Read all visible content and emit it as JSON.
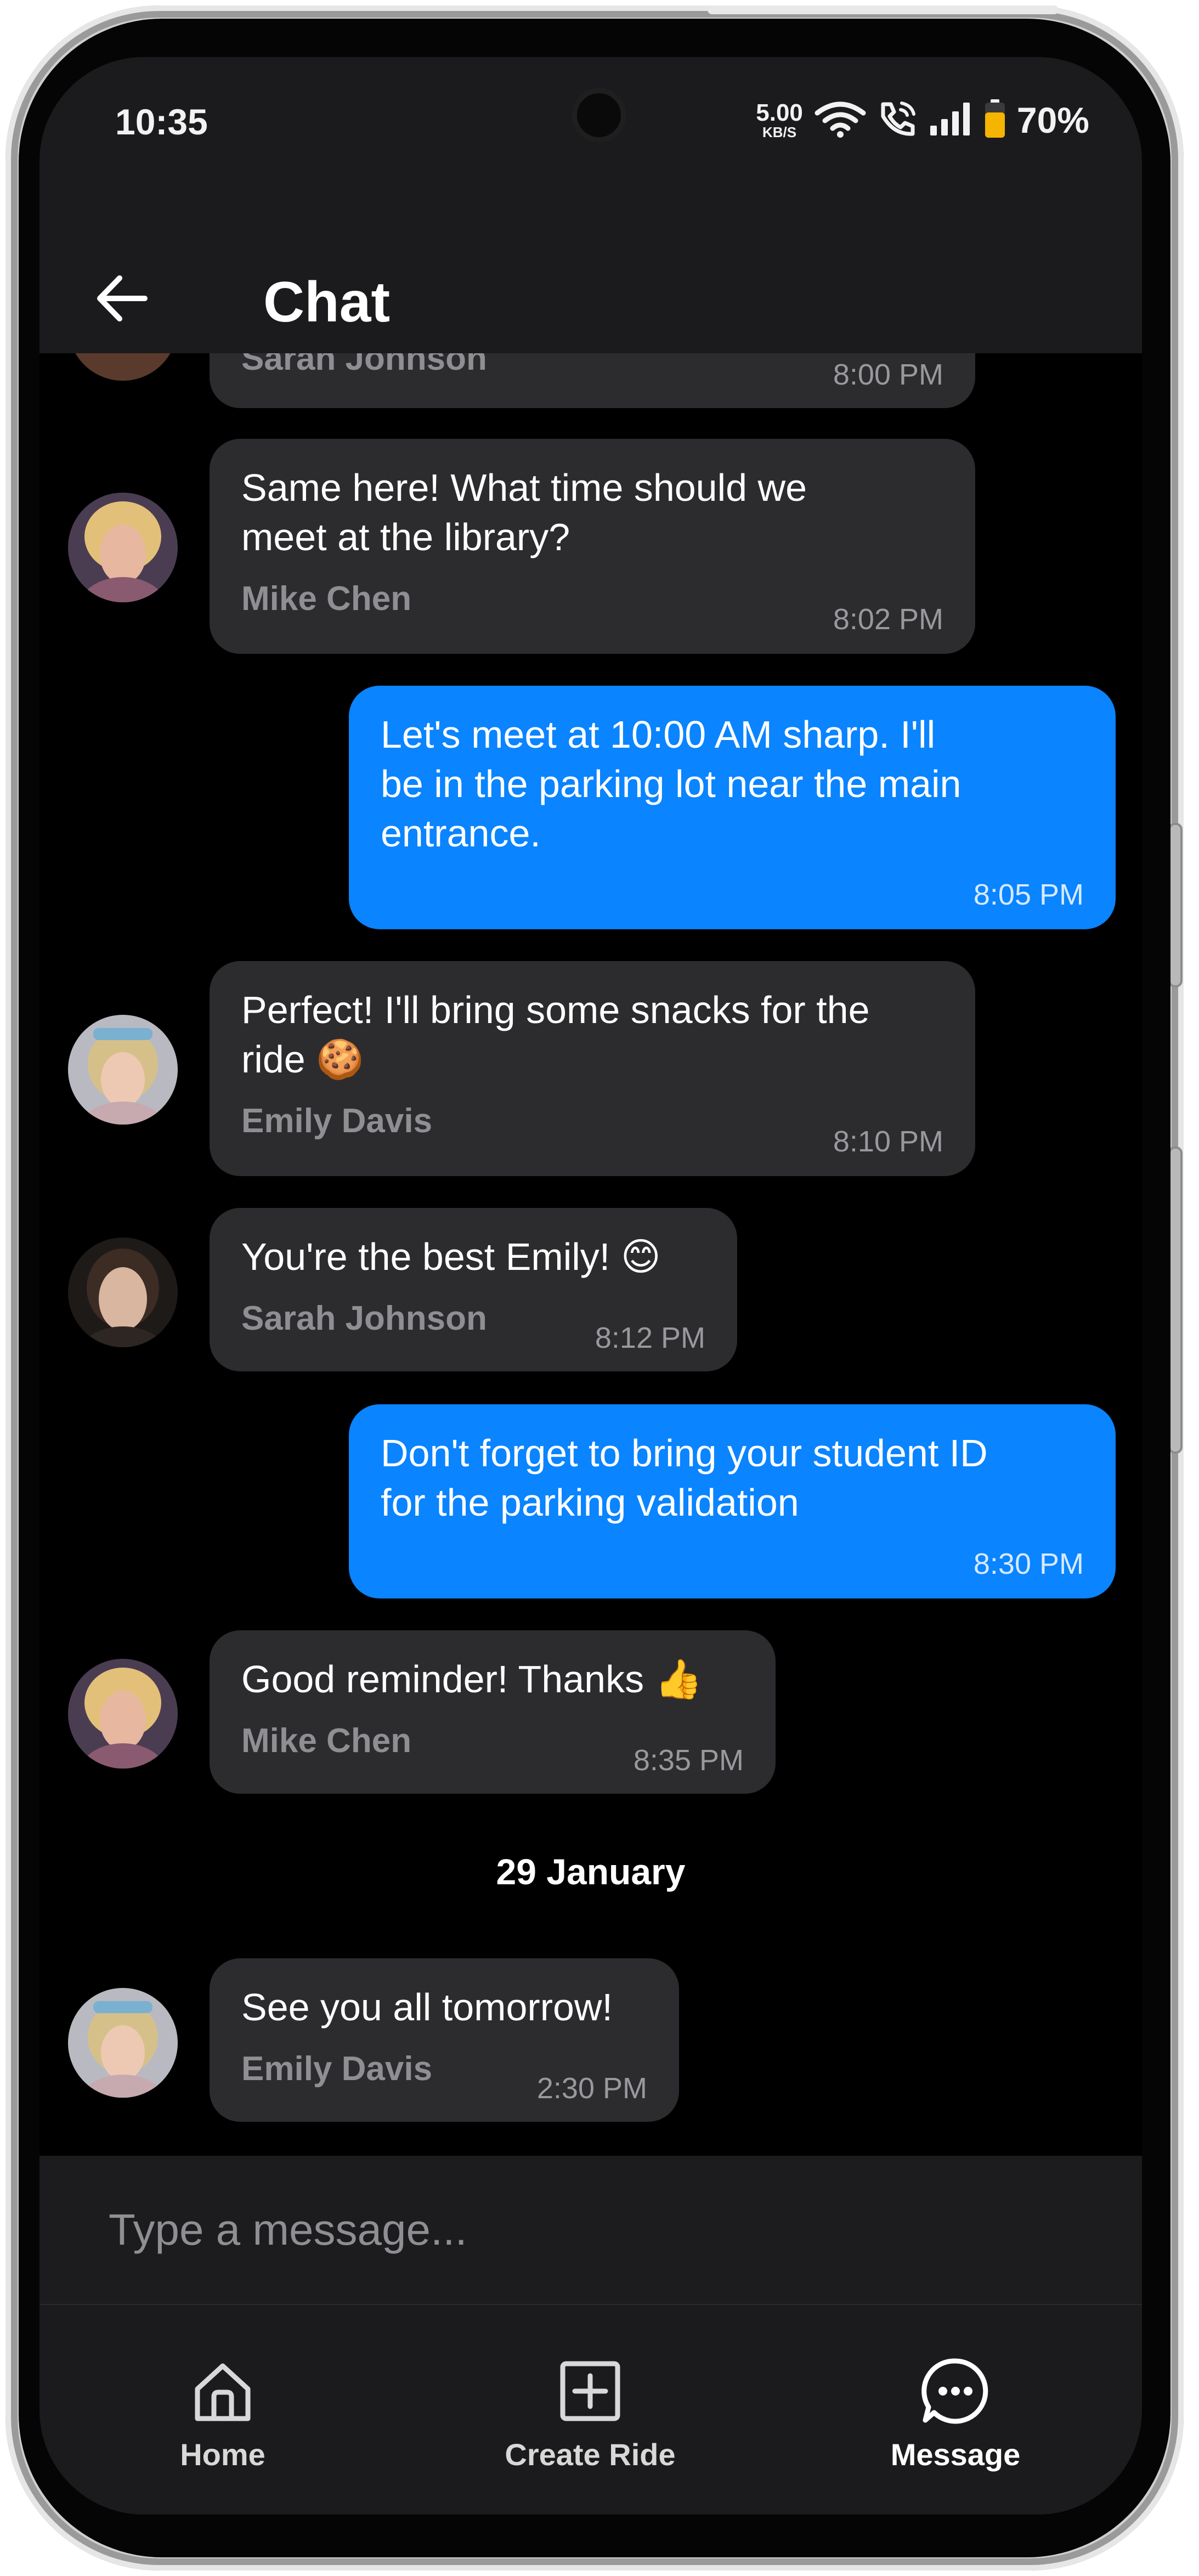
{
  "status_bar": {
    "time": "10:35",
    "net_speed_value": "5.00",
    "net_speed_unit": "KB/S",
    "battery": "70%"
  },
  "header": {
    "title": "Chat"
  },
  "messages": [
    {
      "direction": "in",
      "text": "",
      "sender": "Sarah Johnson",
      "time": "8:00 PM"
    },
    {
      "direction": "in",
      "text": "Same here! What time should we\nmeet at the library?",
      "sender": "Mike Chen",
      "time": "8:02 PM"
    },
    {
      "direction": "out",
      "text": "Let's meet at 10:00 AM sharp. I'll\nbe in the parking lot near the main\nentrance.",
      "time": "8:05 PM"
    },
    {
      "direction": "in",
      "text": "Perfect! I'll bring some snacks for the\nride 🍪",
      "sender": "Emily Davis",
      "time": "8:10 PM"
    },
    {
      "direction": "in",
      "text": "You're the best Emily! 😊",
      "sender": "Sarah Johnson",
      "time": "8:12 PM"
    },
    {
      "direction": "out",
      "text": "Don't forget to bring your student ID\nfor the parking validation",
      "time": "8:30 PM"
    },
    {
      "direction": "in",
      "text": "Good reminder! Thanks 👍",
      "sender": "Mike Chen",
      "time": "8:35 PM"
    },
    {
      "direction": "in",
      "text": "See you all tomorrow!",
      "sender": "Emily Davis",
      "time": "2:30 PM"
    }
  ],
  "date_divider": "29 January",
  "composer": {
    "placeholder": "Type a message..."
  },
  "bottom_nav": {
    "items": [
      {
        "label": "Home",
        "icon": "home-icon"
      },
      {
        "label": "Create Ride",
        "icon": "add-square-icon"
      },
      {
        "label": "Message",
        "icon": "chat-bubble-icon",
        "active": true
      }
    ]
  },
  "colors": {
    "outgoing_bubble": "#0a84ff",
    "incoming_bubble": "#2c2c2e",
    "background": "#000000",
    "bar": "#1b1b1d"
  }
}
